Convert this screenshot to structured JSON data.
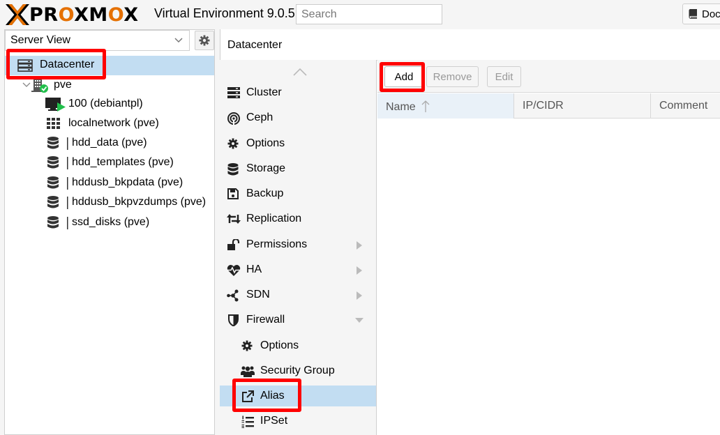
{
  "header": {
    "logo_text_1": "PR",
    "logo_text_2": "O",
    "logo_text_3": "XM",
    "logo_text_4": "O",
    "logo_text_5": "X",
    "product": "Virtual Environment 9.0.5",
    "search_placeholder": "Search",
    "docs_label": "Doc"
  },
  "tree": {
    "view": "Server View",
    "datacenter": "Datacenter",
    "node": "pve",
    "items": [
      {
        "label": "100 (debiantpl)",
        "icon": "vm-running-icon"
      },
      {
        "label": "localnetwork (pve)",
        "icon": "network-grid-icon"
      },
      {
        "label": "hdd_data (pve)",
        "icon": "storage-icon"
      },
      {
        "label": "hdd_templates (pve)",
        "icon": "storage-icon"
      },
      {
        "label": "hddusb_bkpdata (pve)",
        "icon": "storage-icon"
      },
      {
        "label": "hddusb_bkpvzdumps (pve)",
        "icon": "storage-icon"
      },
      {
        "label": "ssd_disks (pve)",
        "icon": "storage-icon"
      }
    ]
  },
  "main": {
    "title": "Datacenter"
  },
  "nav": {
    "items": [
      {
        "label": "Cluster",
        "icon": "server-icon"
      },
      {
        "label": "Ceph",
        "icon": "ceph-icon"
      },
      {
        "label": "Options",
        "icon": "gear-icon"
      },
      {
        "label": "Storage",
        "icon": "database-icon"
      },
      {
        "label": "Backup",
        "icon": "floppy-icon"
      },
      {
        "label": "Replication",
        "icon": "retweet-icon"
      },
      {
        "label": "Permissions",
        "icon": "unlock-icon"
      },
      {
        "label": "HA",
        "icon": "heartbeat-icon"
      },
      {
        "label": "SDN",
        "icon": "sdn-icon"
      },
      {
        "label": "Firewall",
        "icon": "shield-icon"
      },
      {
        "label": "Options",
        "icon": "gear-icon"
      },
      {
        "label": "Security Group",
        "icon": "users-icon"
      },
      {
        "label": "Alias",
        "icon": "external-link-icon"
      },
      {
        "label": "IPSet",
        "icon": "list-ol-icon"
      }
    ]
  },
  "toolbar": {
    "add": "Add",
    "remove": "Remove",
    "edit": "Edit"
  },
  "grid": {
    "columns": [
      "Name",
      "IP/CIDR",
      "Comment"
    ]
  },
  "colors": {
    "accent": "#e57000",
    "selection": "#c2ddf2",
    "highlight": "#ff0000"
  }
}
